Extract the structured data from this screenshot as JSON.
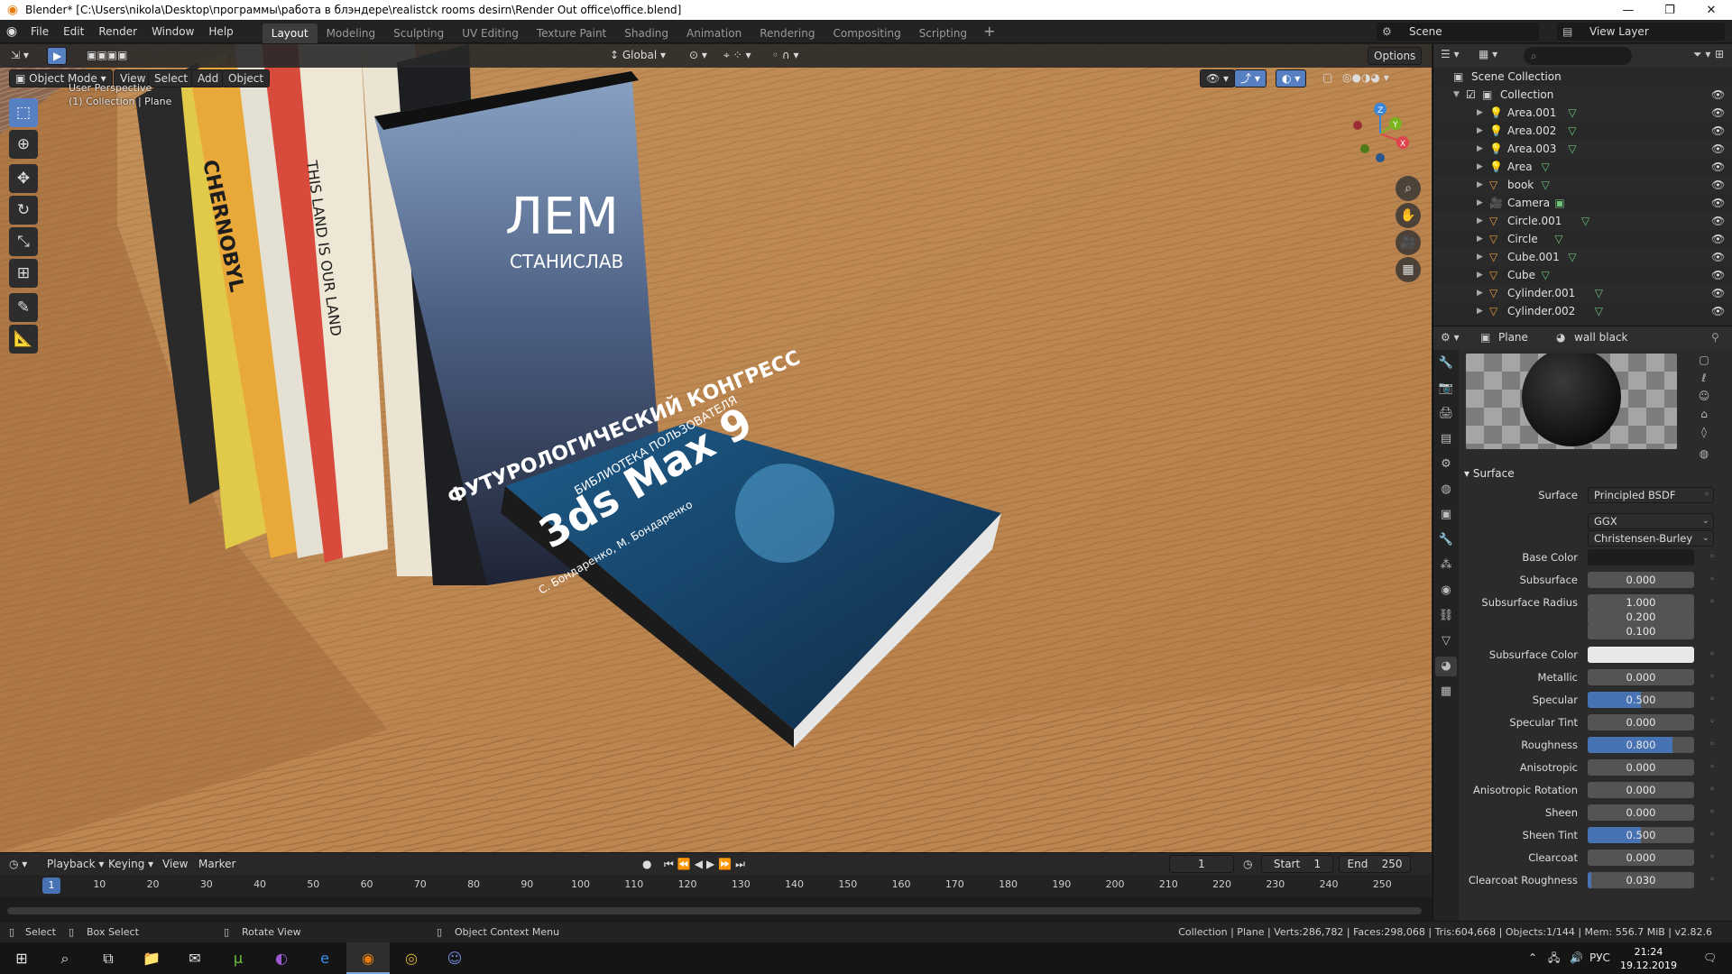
{
  "titlebar": {
    "title": "Blender* [C:\\Users\\nikola\\Desktop\\программы\\работа в блэндере\\realistck rooms desirn\\Render Out office\\office.blend]",
    "minimize": "—",
    "maximize": "❐",
    "close": "✕"
  },
  "menubar": {
    "items": [
      "File",
      "Edit",
      "Render",
      "Window",
      "Help"
    ],
    "workspaces": [
      "Layout",
      "Modeling",
      "Sculpting",
      "UV Editing",
      "Texture Paint",
      "Shading",
      "Animation",
      "Rendering",
      "Compositing",
      "Scripting"
    ],
    "active_workspace": "Layout",
    "scene": "Scene",
    "view_layer": "View Layer"
  },
  "viewport": {
    "mode": "Object Mode",
    "menus": [
      "View",
      "Select",
      "Add",
      "Object"
    ],
    "orientation": "Global",
    "options": "Options",
    "perspective_label": "User Perspective",
    "context_label": "(1) Collection | Plane",
    "axes": [
      "X",
      "Y",
      "Z"
    ]
  },
  "timeline": {
    "menus": [
      "Playback",
      "Keying",
      "View",
      "Marker"
    ],
    "current_frame": "1",
    "start_label": "Start",
    "start": "1",
    "end_label": "End",
    "end": "250",
    "ticks": [
      "1",
      "10",
      "20",
      "30",
      "40",
      "50",
      "60",
      "70",
      "80",
      "90",
      "100",
      "110",
      "120",
      "130",
      "140",
      "150",
      "160",
      "170",
      "180",
      "190",
      "200",
      "210",
      "220",
      "230",
      "240",
      "250"
    ]
  },
  "outliner": {
    "scene_collection": "Scene Collection",
    "collection": "Collection",
    "objects": [
      {
        "name": "Area.001",
        "type": "light"
      },
      {
        "name": "Area.002",
        "type": "light"
      },
      {
        "name": "Area.003",
        "type": "light"
      },
      {
        "name": "Area",
        "type": "light"
      },
      {
        "name": "book",
        "type": "mesh"
      },
      {
        "name": "Camera",
        "type": "camera"
      },
      {
        "name": "Circle.001",
        "type": "mesh"
      },
      {
        "name": "Circle",
        "type": "mesh"
      },
      {
        "name": "Cube.001",
        "type": "mesh"
      },
      {
        "name": "Cube",
        "type": "mesh"
      },
      {
        "name": "Cylinder.001",
        "type": "mesh"
      },
      {
        "name": "Cylinder.002",
        "type": "mesh"
      }
    ]
  },
  "properties": {
    "object": "Plane",
    "material": "wall black",
    "panel": "Surface",
    "surface_label": "Surface",
    "surface_shader": "Principled BSDF",
    "distribution": "GGX",
    "subsurface_method": "Christensen-Burley",
    "rows": [
      {
        "label": "Base Color",
        "value": "",
        "kind": "color-dark"
      },
      {
        "label": "Subsurface",
        "value": "0.000",
        "kind": "num",
        "fill": 0
      },
      {
        "label": "Subsurface Radius",
        "value": "1.000",
        "kind": "num",
        "fill": 0
      },
      {
        "label": "",
        "value": "0.200",
        "kind": "num",
        "fill": 0
      },
      {
        "label": "",
        "value": "0.100",
        "kind": "num",
        "fill": 0
      },
      {
        "label": "Subsurface Color",
        "value": "",
        "kind": "color-light"
      },
      {
        "label": "Metallic",
        "value": "0.000",
        "kind": "num",
        "fill": 0
      },
      {
        "label": "Specular",
        "value": "0.500",
        "kind": "num",
        "fill": 0.5
      },
      {
        "label": "Specular Tint",
        "value": "0.000",
        "kind": "num",
        "fill": 0
      },
      {
        "label": "Roughness",
        "value": "0.800",
        "kind": "num",
        "fill": 0.8
      },
      {
        "label": "Anisotropic",
        "value": "0.000",
        "kind": "num",
        "fill": 0
      },
      {
        "label": "Anisotropic Rotation",
        "value": "0.000",
        "kind": "num",
        "fill": 0
      },
      {
        "label": "Sheen",
        "value": "0.000",
        "kind": "num",
        "fill": 0
      },
      {
        "label": "Sheen Tint",
        "value": "0.500",
        "kind": "num",
        "fill": 0.5
      },
      {
        "label": "Clearcoat",
        "value": "0.000",
        "kind": "num",
        "fill": 0
      },
      {
        "label": "Clearcoat Roughness",
        "value": "0.030",
        "kind": "num",
        "fill": 0.03
      }
    ]
  },
  "statusbar": {
    "select": "Select",
    "box_select": "Box Select",
    "rotate_view": "Rotate View",
    "context_menu": "Object Context Menu",
    "stats": "Collection | Plane | Verts:286,782 | Faces:298,068 | Tris:604,668 | Objects:1/144 | Mem: 556.7 MiB | v2.82.6"
  },
  "taskbar": {
    "language": "РУС",
    "time": "21:24",
    "date": "19.12.2019"
  },
  "books": {
    "lem_title": "ЛЕМ",
    "lem_author": "СТАНИСЛАВ",
    "lem_subtitle": "ФУТУРОЛОГИЧЕСКИЙ КОНГРЕСС",
    "max_title": "3ds Max 9",
    "max_authors": "С. Бондаренко, М. Бондаренко",
    "max_series": "БИБЛИОТЕКА ПОЛЬЗОВАТЕЛЯ",
    "spine1": "CHERNOBYL",
    "spine2": "THIS LAND IS OUR LAND"
  },
  "colors": {
    "accent": "#4772b3",
    "wood": "#b07a44",
    "orange": "#e87d0d"
  }
}
